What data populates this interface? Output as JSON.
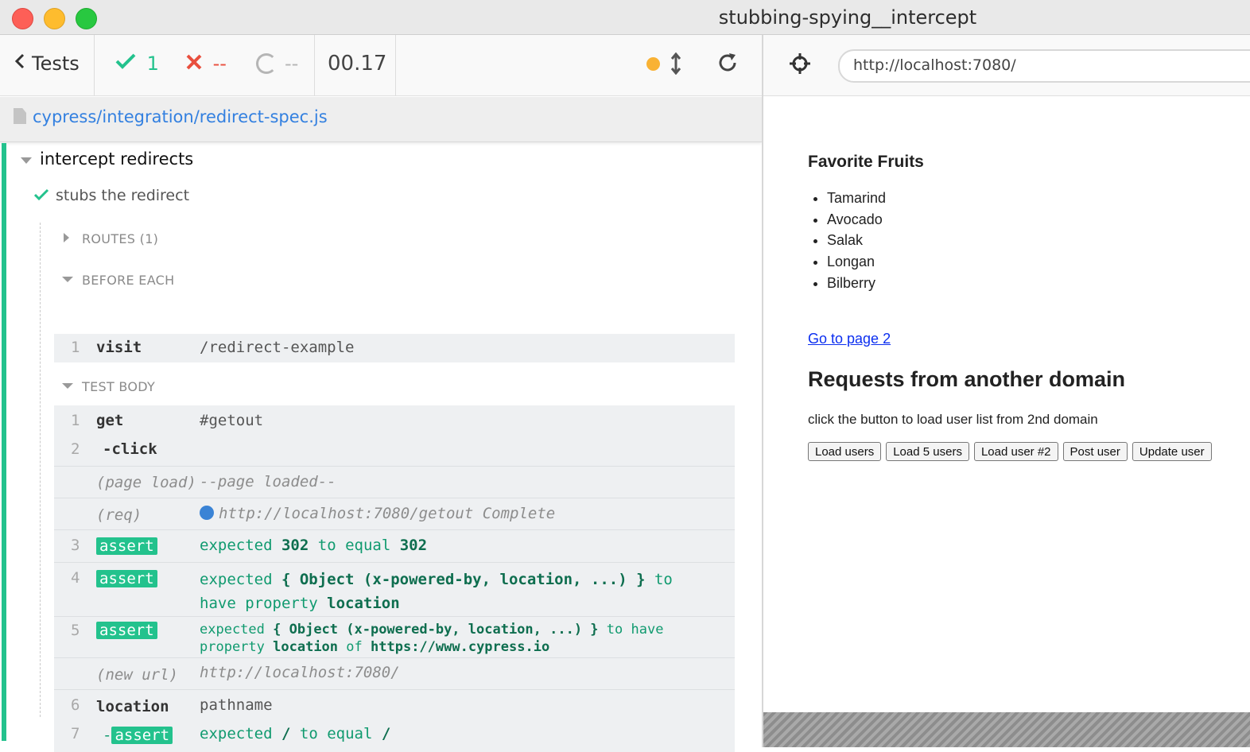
{
  "window": {
    "title": "stubbing-spying__intercept"
  },
  "toolbar": {
    "tests_label": "Tests",
    "passed_count": "1",
    "failed_count": "--",
    "pending_count": "--",
    "duration": "00.17"
  },
  "spec": {
    "path": "cypress/integration/redirect-spec.js"
  },
  "suite": {
    "title": "intercept redirects",
    "test_title": "stubs the redirect",
    "routes_label": "ROUTES (1)",
    "before_each_label": "BEFORE EACH",
    "test_body_label": "TEST BODY",
    "before_each": [
      {
        "num": "1",
        "name": "visit",
        "message": "/redirect-example"
      }
    ],
    "body": [
      {
        "num": "1",
        "name": "get",
        "message": "#getout"
      },
      {
        "num": "2",
        "name": "-click",
        "message": ""
      },
      {
        "num": "",
        "name": "(page load)",
        "message": "--page loaded--"
      },
      {
        "num": "",
        "name": "(req)",
        "message": "http://localhost:7080/getout Complete"
      },
      {
        "num": "3",
        "name": "assert",
        "message": [
          "expected",
          "302",
          "to equal",
          "302"
        ]
      },
      {
        "num": "4",
        "name": "assert",
        "message": [
          "expected",
          "{ Object (x-powered-by, location, ...) }",
          "to",
          "have property",
          "location"
        ]
      },
      {
        "num": "5",
        "name": "assert",
        "message": [
          "expected",
          "{ Object (x-powered-by, location, ...) }",
          "to have",
          "property",
          "location",
          "of",
          "https://www.cypress.io"
        ]
      },
      {
        "num": "",
        "name": "(new url)",
        "message": "http://localhost:7080/"
      },
      {
        "num": "6",
        "name": "location",
        "message": "pathname"
      },
      {
        "num": "7",
        "name": "assert",
        "prefix": "-",
        "message": [
          "expected",
          "/",
          "to equal",
          "/"
        ]
      }
    ]
  },
  "aut": {
    "url": "http://localhost:7080/",
    "fruits_heading": "Favorite Fruits",
    "fruits": [
      "Tamarind",
      "Avocado",
      "Salak",
      "Longan",
      "Bilberry"
    ],
    "page2_link": "Go to page 2",
    "requests_heading": "Requests from another domain",
    "description": "click the button to load user list from 2nd domain",
    "buttons": [
      "Load users",
      "Load 5 users",
      "Load user #2",
      "Post user",
      "Update user"
    ]
  },
  "colors": {
    "accent_green": "#23c28d",
    "failed_red": "#e94f3e",
    "link_blue": "#3380e0",
    "running_dot": "#f9b234"
  },
  "icons": [
    "chevron-left-icon",
    "check-icon",
    "x-icon",
    "spinner-icon",
    "resize-icon",
    "reload-icon",
    "file-icon",
    "crosshair-icon",
    "req-dot-icon"
  ]
}
